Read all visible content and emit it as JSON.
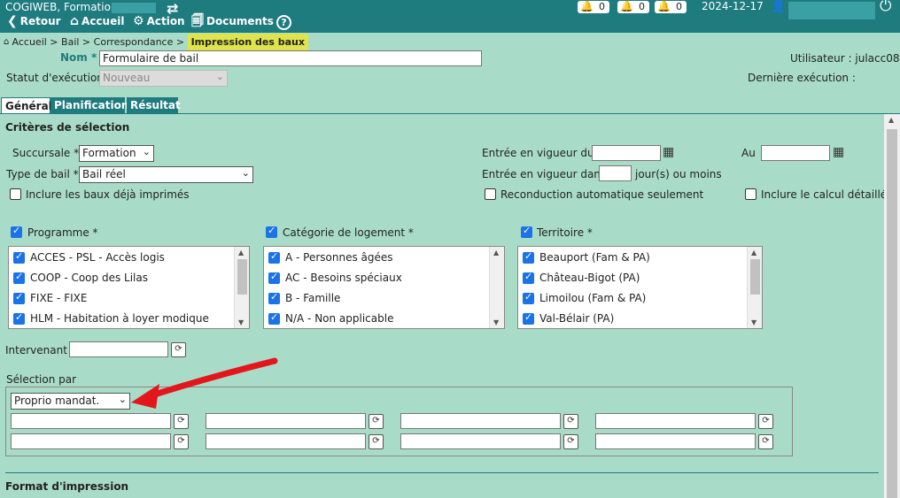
{
  "topbar": {
    "app_title": "COGIWEB, Formation",
    "nav": [
      {
        "icon": "back-arrow-icon",
        "label": "Retour"
      },
      {
        "icon": "home-icon",
        "label": "Accueil"
      },
      {
        "icon": "gear-icon",
        "label": "Action"
      },
      {
        "icon": "documents-icon",
        "label": "Documents"
      }
    ],
    "alerts": [
      {
        "color": "#e53935",
        "count": "0"
      },
      {
        "color": "#f6b500",
        "count": "0"
      },
      {
        "color": "#2e9e44",
        "count": "0"
      }
    ],
    "date": "2024-12-17"
  },
  "breadcrumb": {
    "items": [
      "Accueil",
      "Bail",
      "Correspondance"
    ],
    "current": "Impression des baux"
  },
  "header": {
    "nom_label": "Nom",
    "nom_value": "Formulaire de bail",
    "user_label": "Utilisateur : julacc08",
    "statut_label": "Statut d'exécution",
    "statut_value": "Nouveau",
    "last_exec_label": "Dernière exécution :"
  },
  "tabs": [
    "Général",
    "Planification",
    "Résultat"
  ],
  "criteria": {
    "title": "Critères de sélection",
    "succursale_label": "Succursale *",
    "succursale_value": "Formation",
    "type_bail_label": "Type de bail *",
    "type_bail_value": "Bail réel",
    "include_printed_label": "Inclure les baux déjà imprimés",
    "effective_from_label": "Entrée en vigueur du",
    "au_label": "Au",
    "effective_in_label": "Entrée en vigueur dans",
    "days_suffix": "jour(s) ou moins",
    "auto_renew_label": "Reconduction automatique seulement",
    "detailed_calc_label": "Inclure le calcul détaillé"
  },
  "lists": {
    "programme": {
      "label": "Programme *",
      "items": [
        "ACCES - PSL - Accès logis",
        "COOP - Coop des Lilas",
        "FIXE - FIXE",
        "HLM - Habitation à loyer modique"
      ]
    },
    "categorie": {
      "label": "Catégorie de logement *",
      "items": [
        "A - Personnes âgées",
        "AC - Besoins spéciaux",
        "B - Famille",
        "N/A - Non applicable"
      ]
    },
    "territoire": {
      "label": "Territoire *",
      "items": [
        "Beauport (Fam & PA)",
        "Château-Bigot (PA)",
        "Limoilou (Fam & PA)",
        "Val-Bélair (PA)"
      ]
    }
  },
  "intervenant_label": "Intervenant",
  "selection": {
    "label": "Sélection par",
    "value": "Proprio mandat."
  },
  "format_title": "Format d'impression",
  "annotation": {
    "arrow_color": "#e3161b"
  }
}
